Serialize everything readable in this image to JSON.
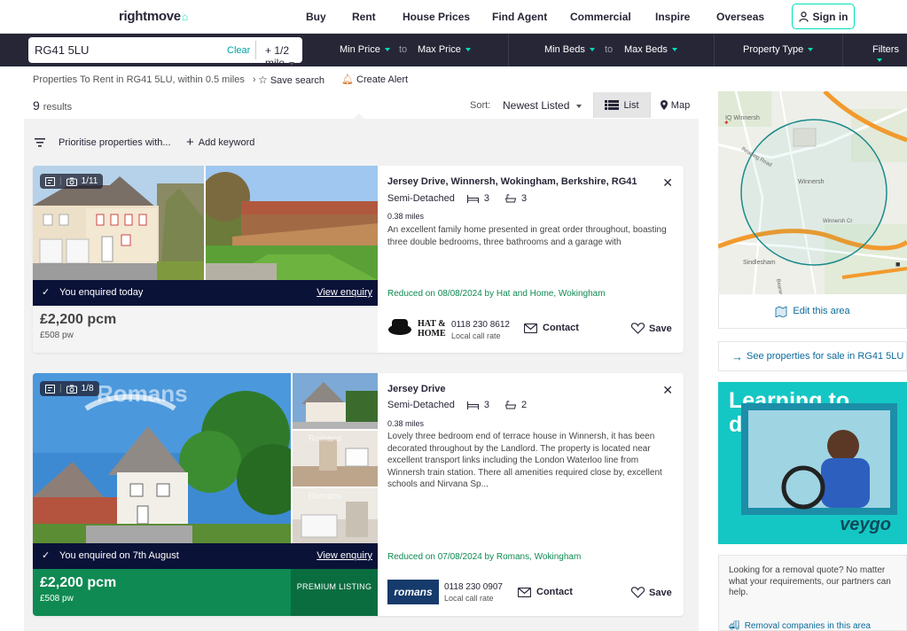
{
  "nav": {
    "logo": "rightmove",
    "links": [
      "Buy",
      "Rent",
      "House Prices",
      "Find Agent",
      "Commercial",
      "Inspire",
      "Overseas"
    ],
    "signin": "Sign in"
  },
  "search": {
    "location": "RG41 5LU",
    "clear": "Clear",
    "radius": "+ 1/2 mile",
    "min_price": "Min Price",
    "to1": "to",
    "max_price": "Max Price",
    "min_beds": "Min Beds",
    "to2": "to",
    "max_beds": "Max Beds",
    "property_type": "Property Type",
    "filters": "Filters"
  },
  "breadcrumb": {
    "text": "Properties To Rent in RG41 5LU, within 0.5 miles",
    "save_search": "Save search",
    "create_alert": "Create Alert"
  },
  "results": {
    "count": "9",
    "count_label": "results",
    "sort_label": "Sort:",
    "sort_value": "Newest Listed",
    "list_label": "List",
    "map_label": "Map",
    "prioritise": "Prioritise properties with...",
    "add_keyword": "Add keyword"
  },
  "listings": [
    {
      "photo_count": "1/11",
      "address": "Jersey Drive, Winnersh, Wokingham, Berkshire, RG41",
      "type": "Semi-Detached",
      "beds": "3",
      "baths": "3",
      "distance": "0.38 miles",
      "description": "An excellent family home presented in great order throughout, boasting three double bedrooms, three bathrooms and a garage with",
      "reduced": "Reduced on 08/08/2024 by Hat and Home, Wokingham",
      "enquired": "You enquired today",
      "view_enquiry": "View enquiry",
      "price": "£2,200 pcm",
      "price_pw": "£508 pw",
      "agent_logo": "HAT & HOME",
      "phone": "0118 230 8612",
      "phone_note": "Local call rate",
      "contact": "Contact",
      "save": "Save"
    },
    {
      "photo_count": "1/8",
      "address": "Jersey Drive",
      "type": "Semi-Detached",
      "beds": "3",
      "baths": "2",
      "distance": "0.38 miles",
      "description": "Lovely three bedroom end of terrace house in Winnersh, it has been decorated throughout by the Landlord. The property is located near excellent transport links including the London Waterloo line from Winnersh train station. There all amenities required close by, excellent schools and Nirvana Sp...",
      "reduced": "Reduced on 07/08/2024 by Romans, Wokingham",
      "enquired": "You enquired on 7th August",
      "view_enquiry": "View enquiry",
      "price": "£2,200 pcm",
      "price_pw": "£508 pw",
      "premium": "PREMIUM LISTING",
      "agent_logo": "romans",
      "watermark": "Romans",
      "phone": "0118 230 0907",
      "phone_note": "Local call rate",
      "contact": "Contact",
      "save": "Save"
    }
  ],
  "map": {
    "labels": [
      "IQ Winnersh",
      "Winnersh",
      "Winnersh Cr",
      "Sindlesham",
      "Reading Road",
      "Bearwood"
    ],
    "edit_area": "Edit this area"
  },
  "sidebar": {
    "for_sale": "See properties for sale in RG41 5LU",
    "ad_headline": "Learning to drive?",
    "ad_brand": "veygo",
    "removal_text": "Looking for a removal quote? No matter what your requirements, our partners can help.",
    "removal_link": "Removal companies in this area"
  },
  "colors": {
    "brand_teal": "#00deb6",
    "dark_navy": "#262637",
    "enquired_bar": "#0b1238",
    "reduced_green": "#0f8a52",
    "link_blue": "#0c6b9c"
  }
}
